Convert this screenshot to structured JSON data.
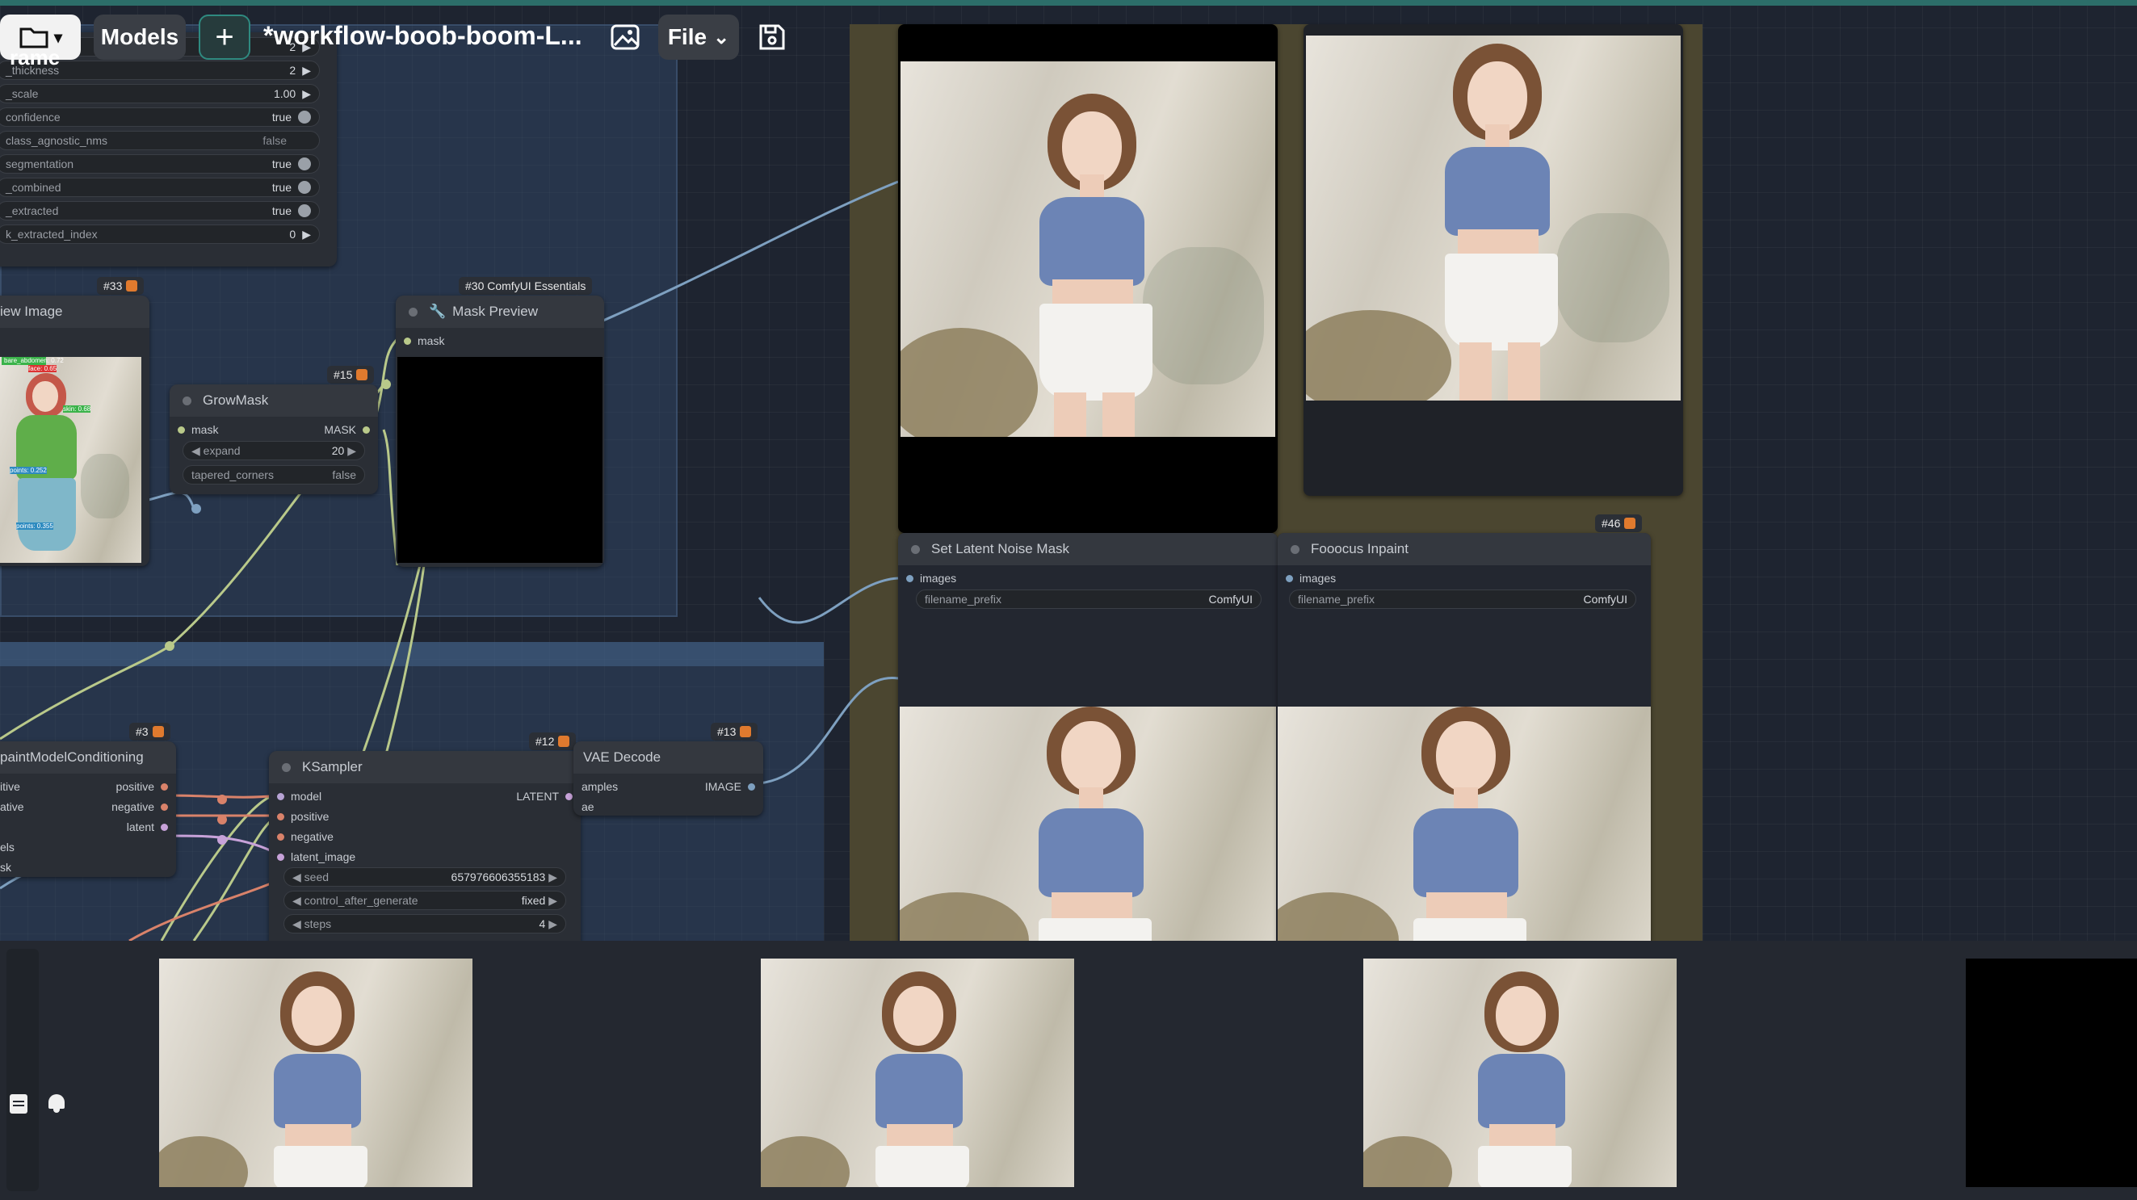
{
  "toolbar": {
    "folder_icon": "folder-icon",
    "models_label": "Models",
    "add_label": "+",
    "workflow_title": "*workflow-boob-boom-L...",
    "image_icon": "image-icon",
    "file_label": "File",
    "save_icon": "save-icon",
    "overlay_label": "rame"
  },
  "detector_node": {
    "rows": [
      {
        "label": "th...",
        "value": "2",
        "kind": "number"
      },
      {
        "label": "_thickness",
        "value": "2",
        "kind": "number"
      },
      {
        "label": "_scale",
        "value": "1.00",
        "kind": "number"
      },
      {
        "label": "confidence",
        "value": "true",
        "kind": "toggle"
      },
      {
        "label": "class_agnostic_nms",
        "value": "false",
        "kind": "toggle-off"
      },
      {
        "label": "segmentation",
        "value": "true",
        "kind": "toggle"
      },
      {
        "label": "_combined",
        "value": "true",
        "kind": "toggle"
      },
      {
        "label": "_extracted",
        "value": "true",
        "kind": "toggle"
      },
      {
        "label": "k_extracted_index",
        "value": "0",
        "kind": "number"
      }
    ]
  },
  "preview_image_node": {
    "badge": "#33",
    "title": "iew Image",
    "det_labels": [
      "bare_abdomen: 0.72",
      "face: 0.65",
      "skin: 0.68",
      "points: 0.252",
      "points: 0.355"
    ]
  },
  "growmask_node": {
    "badge": "#15",
    "title": "GrowMask",
    "input": "mask",
    "output": "MASK",
    "expand_label": "expand",
    "expand_value": "20",
    "tapered_label": "tapered_corners",
    "tapered_value": "false"
  },
  "mask_preview_node": {
    "badge": "#30 ComfyUI Essentials",
    "title": "Mask Preview",
    "input": "mask"
  },
  "inpaint_cond_node": {
    "badge": "#3",
    "title": "paintModelConditioning",
    "inputs": [
      "itive",
      "ative",
      "",
      "els",
      "sk"
    ],
    "outputs": [
      "positive",
      "negative",
      "latent"
    ]
  },
  "ksampler_node": {
    "badge": "#12",
    "title": "KSampler",
    "inputs": [
      "model",
      "positive",
      "negative",
      "latent_image"
    ],
    "output": "LATENT",
    "seed_label": "seed",
    "seed_value": "657976606355183",
    "cag_label": "control_after_generate",
    "cag_value": "fixed",
    "steps_label": "steps",
    "steps_value": "4"
  },
  "vae_decode_node": {
    "badge": "#13",
    "title": "VAE Decode",
    "inputs": [
      "amples",
      "ae"
    ],
    "output": "IMAGE"
  },
  "latent_noise_node": {
    "title": "Set Latent Noise Mask",
    "input": "images",
    "prefix_label": "filename_prefix",
    "prefix_value": "ComfyUI"
  },
  "fooocus_node": {
    "badge": "#46",
    "title": "Fooocus Inpaint",
    "input": "images",
    "prefix_label": "filename_prefix",
    "prefix_value": "ComfyUI"
  },
  "sidebar_icons": [
    "queue-icon",
    "bell-icon"
  ],
  "colors": {
    "canvas": "#1e2430",
    "group_blue": "#2a3a52",
    "group_olive": "#4b4630",
    "accent_teal": "#2c6e69"
  }
}
